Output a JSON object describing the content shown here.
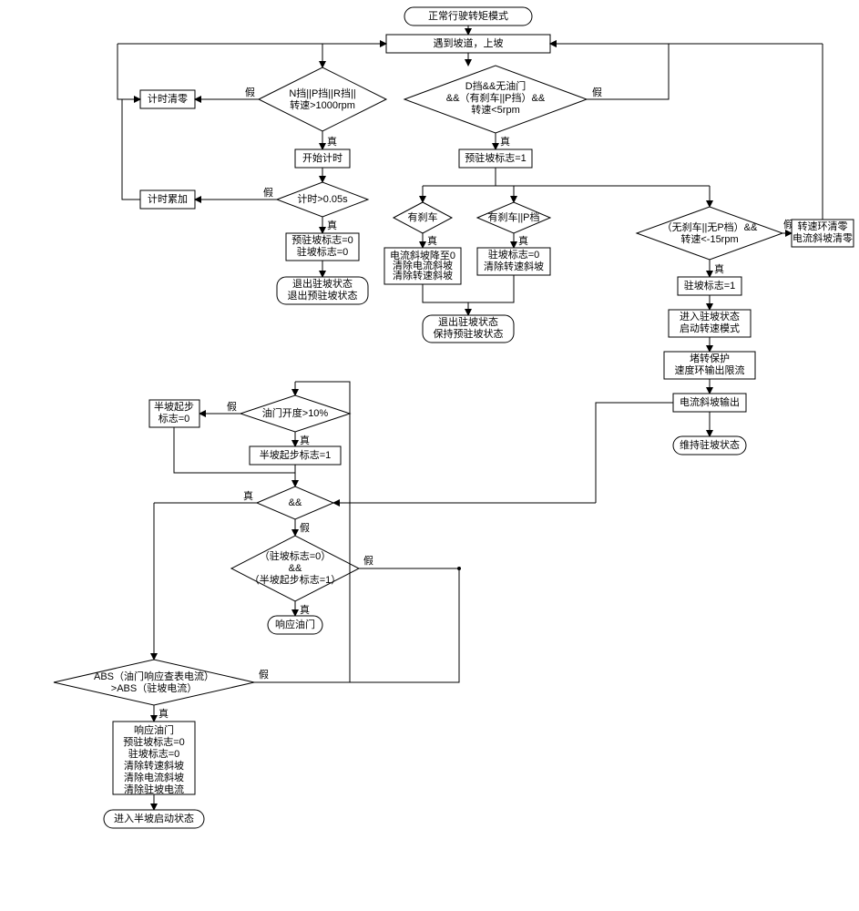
{
  "terminals": {
    "start": "正常行驶转矩模式",
    "exit_hold": "退出驻坡状态\n退出预驻坡状态",
    "exit_keep_pre": "退出驻坡状态\n保持预驻坡状态",
    "maintain_hold": "维持驻坡状态",
    "respond_throttle": "响应油门",
    "enter_half_hill": "进入半坡启动状态"
  },
  "processes": {
    "slope_uphill": "遇到坡道，上坡",
    "timer_clear": "计时清零",
    "start_timer": "开始计时",
    "timer_acc": "计时累加",
    "pre_hold_0": "预驻坡标志=0\n驻坡标志=0",
    "pre_hold_1": "预驻坡标志=1",
    "brake_true_actions": "电流斜坡降至0\n清除电流斜坡\n清除转速斜坡",
    "hold_0_clear_speed": "驻坡标志=0\n清除转速斜坡",
    "speed_loop_clear": "转速环清零\n电流斜坡清零",
    "hold_1": "驻坡标志=1",
    "enter_hold_speed": "进入驻坡状态\n启动转速模式",
    "stall_protect": "堵转保护\n速度环输出限流",
    "current_ramp_out": "电流斜坡输出",
    "half_hill_0": "半坡起步\n标志=0",
    "half_hill_1": "半坡起步标志=1",
    "respond_actions": "响应油门\n预驻坡标志=0\n驻坡标志=0\n清除转速斜坡\n清除电流斜坡\n清除驻坡电流"
  },
  "decisions": {
    "npr_gear": "N挡||P挡||R挡||\n转速>1000rpm",
    "d_gear": "D挡&&无油门\n&&（有刹车||P挡）&&\n转速<5rpm",
    "timer_gt": "计时>0.05s",
    "has_brake": "有刹车",
    "has_brake_or_p": "有刹车||P档",
    "no_brake_no_p": "（无刹车||无P档）&&\n转速<-15rpm",
    "throttle_10": "油门开度>10%",
    "and_gate": "&&",
    "hold0_half1": "（驻坡标志=0）\n&&\n（半坡起步标志=1）",
    "abs_cmp": "ABS（油门响应查表电流）\n>ABS（驻坡电流）"
  },
  "edges": {
    "true": "真",
    "false": "假"
  }
}
